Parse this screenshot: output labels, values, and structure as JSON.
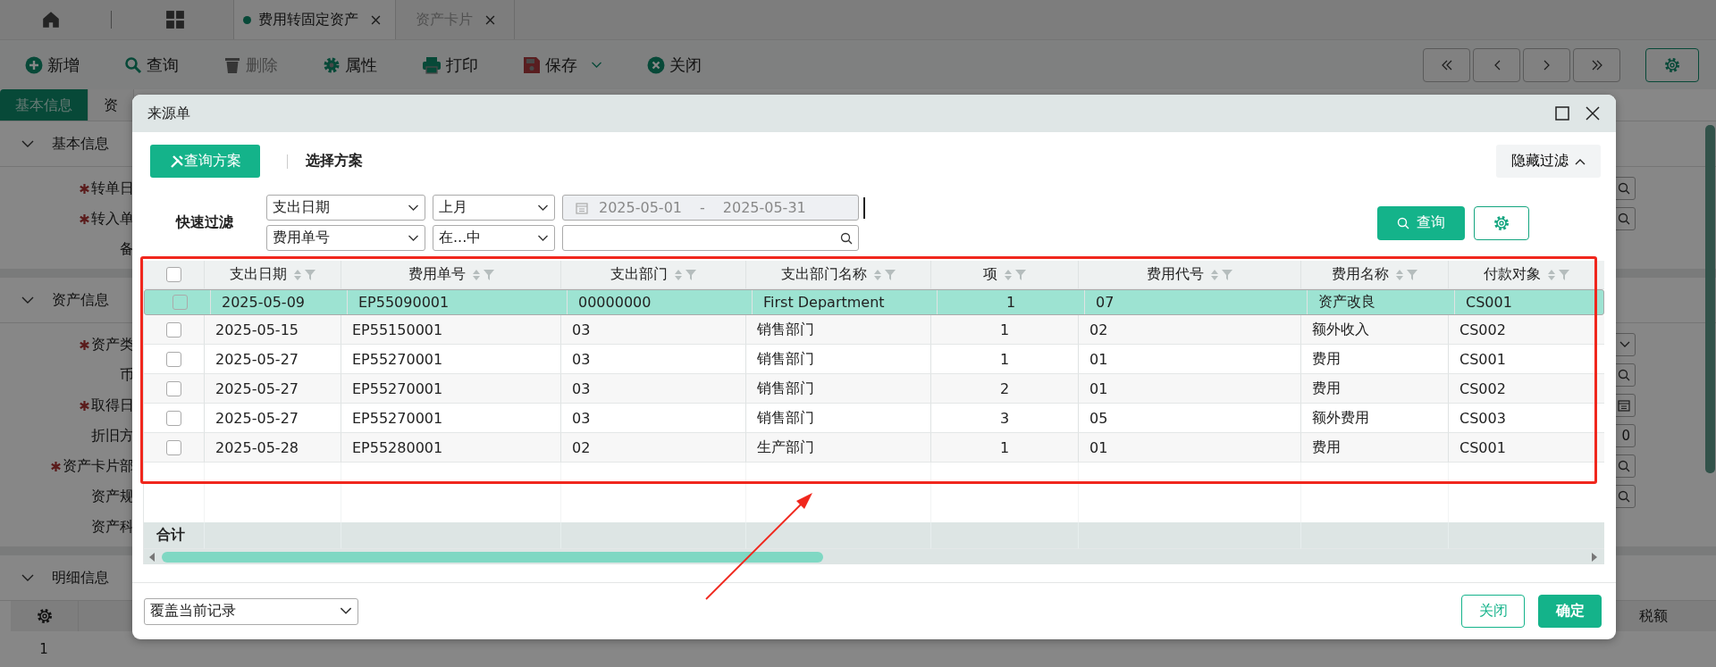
{
  "top_tabs": [
    {
      "label": "费用转固定资产",
      "selected": true,
      "modified": true
    },
    {
      "label": "资产卡片",
      "selected": false,
      "modified": false
    }
  ],
  "toolbar": [
    {
      "label": "新增",
      "kind": "add",
      "disabled": false
    },
    {
      "label": "查询",
      "kind": "query",
      "disabled": false
    },
    {
      "label": "删除",
      "kind": "delete",
      "disabled": true
    },
    {
      "label": "属性",
      "kind": "properties",
      "disabled": false
    },
    {
      "label": "打印",
      "kind": "print",
      "disabled": false
    },
    {
      "label": "保存",
      "kind": "save",
      "disabled": false,
      "dropdown": true
    },
    {
      "label": "关闭",
      "kind": "close",
      "disabled": false
    }
  ],
  "page_tabs": [
    {
      "label": "基本信息",
      "selected": true
    },
    {
      "label": "资",
      "selected": false
    }
  ],
  "sections": [
    {
      "title": "基本信息",
      "expanded": true,
      "fields": [
        {
          "label": "转单日",
          "required": true,
          "kind": "lookup"
        },
        {
          "label": "转入单",
          "required": true,
          "kind": "lookup"
        },
        {
          "label": "备",
          "required": false
        }
      ]
    },
    {
      "title": "资产信息",
      "expanded": true,
      "fields": [
        {
          "label": "资产类",
          "required": true,
          "kind": "dropdown"
        },
        {
          "label": "币",
          "required": false,
          "kind": "lookup"
        },
        {
          "label": "取得日",
          "required": true,
          "kind": "date"
        },
        {
          "label": "折旧方",
          "required": false,
          "kind": "number",
          "value": "0"
        },
        {
          "label": "资产卡片部",
          "required": true,
          "kind": "lookup"
        },
        {
          "label": "资产规",
          "required": false,
          "kind": "lookup"
        },
        {
          "label": "资产科",
          "required": false
        }
      ]
    }
  ],
  "detail_section": {
    "title": "明细信息",
    "expanded": true,
    "row_number": "1",
    "last_column": "税额"
  },
  "dialog": {
    "title": "来源单",
    "scheme_button": "查询方案",
    "scheme_label": "选择方案",
    "hide_filter": "隐藏过滤",
    "quick_filter_label": "快速过滤",
    "query_button": "查询",
    "filters": [
      {
        "field": "支出日期",
        "operator": "上月",
        "kind": "date_range",
        "from": "2025-05-01",
        "separator": "-",
        "to": "2025-05-31",
        "disabled": true
      },
      {
        "field": "费用单号",
        "operator": "在...中",
        "kind": "search"
      }
    ],
    "table": {
      "all_checked": false,
      "total_label": "合计",
      "columns": [
        {
          "label": "支出日期",
          "kind": "text"
        },
        {
          "label": "费用单号",
          "kind": "text"
        },
        {
          "label": "支出部门",
          "kind": "text"
        },
        {
          "label": "支出部门名称",
          "kind": "text"
        },
        {
          "label": "项",
          "kind": "count"
        },
        {
          "label": "费用代号",
          "kind": "text"
        },
        {
          "label": "费用名称",
          "kind": "text"
        },
        {
          "label": "付款对象",
          "kind": "text"
        }
      ],
      "rows": [
        {
          "selected": true,
          "checked": false,
          "cells": [
            "2025-05-09",
            "EP55090001",
            "00000000",
            "First Department",
            "1",
            "07",
            "资产改良",
            "CS001"
          ]
        },
        {
          "selected": false,
          "checked": false,
          "cells": [
            "2025-05-15",
            "EP55150001",
            "03",
            "销售部门",
            "1",
            "02",
            "额外收入",
            "CS002"
          ]
        },
        {
          "selected": false,
          "checked": false,
          "cells": [
            "2025-05-27",
            "EP55270001",
            "03",
            "销售部门",
            "1",
            "01",
            "费用",
            "CS001"
          ]
        },
        {
          "selected": false,
          "checked": false,
          "cells": [
            "2025-05-27",
            "EP55270001",
            "03",
            "销售部门",
            "2",
            "01",
            "费用",
            "CS002"
          ]
        },
        {
          "selected": false,
          "checked": false,
          "cells": [
            "2025-05-27",
            "EP55270001",
            "03",
            "销售部门",
            "3",
            "05",
            "额外费用",
            "CS003"
          ]
        },
        {
          "selected": false,
          "checked": false,
          "cells": [
            "2025-05-28",
            "EP55280001",
            "02",
            "生产部门",
            "1",
            "01",
            "费用",
            "CS001"
          ]
        }
      ]
    },
    "mode_select": "覆盖当前记录",
    "buttons": [
      {
        "label": "关闭",
        "kind": "secondary"
      },
      {
        "label": "确定",
        "kind": "primary"
      }
    ]
  },
  "annotation": {
    "kind": "box_arrow"
  }
}
